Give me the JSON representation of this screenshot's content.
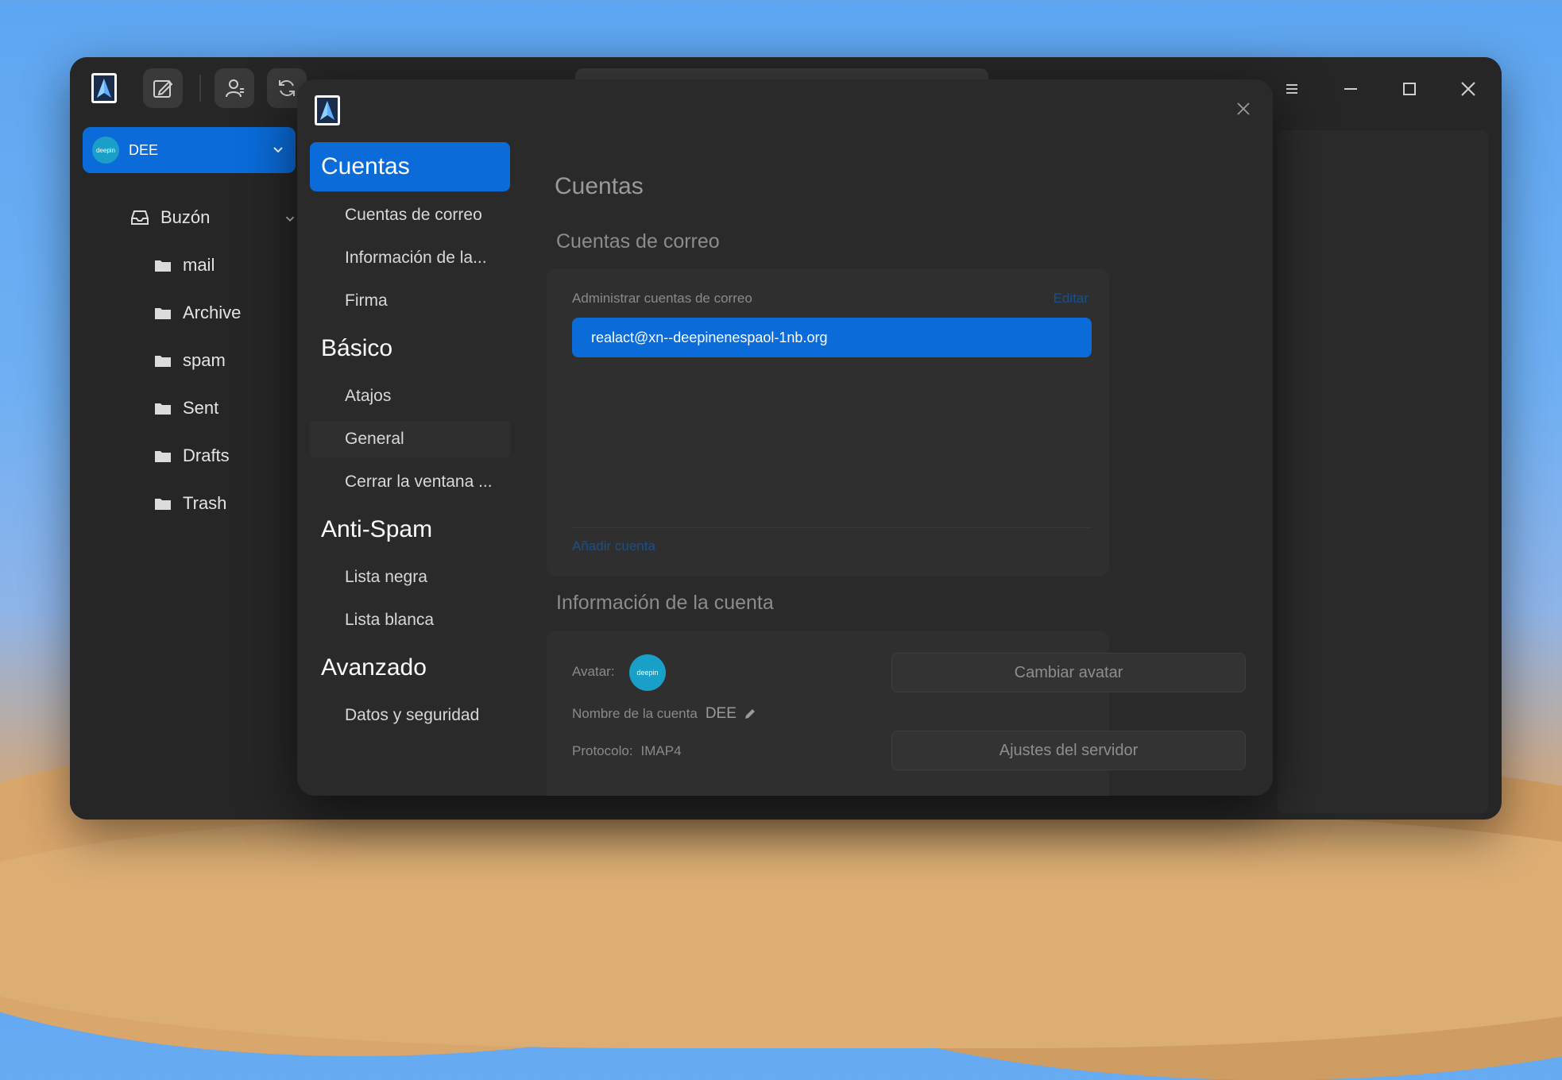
{
  "window": {
    "toolbar": {
      "logo_icon": "deepin-mail-logo-icon",
      "compose_icon": "compose-icon",
      "contacts_icon": "contacts-icon",
      "refresh_icon": "refresh-icon"
    },
    "controls": [
      "menu-icon",
      "minimize-icon",
      "maximize-icon",
      "close-icon"
    ]
  },
  "sidebar": {
    "account": {
      "name": "DEE",
      "avatar_text": "deepin"
    },
    "mailbox": {
      "label": "Buzón"
    },
    "folders": [
      {
        "label": "mail"
      },
      {
        "label": "Archive"
      },
      {
        "label": "spam"
      },
      {
        "label": "Sent"
      },
      {
        "label": "Drafts"
      },
      {
        "label": "Trash"
      }
    ]
  },
  "dialog": {
    "nav": {
      "sections": [
        {
          "title": "Cuentas",
          "items": [
            "Cuentas de correo",
            "Información de la...",
            "Firma"
          ]
        },
        {
          "title": "Básico",
          "items": [
            "Atajos",
            "General",
            "Cerrar la ventana ..."
          ]
        },
        {
          "title": "Anti-Spam",
          "items": [
            "Lista negra",
            "Lista blanca"
          ]
        },
        {
          "title": "Avanzado",
          "items": [
            "Datos y seguridad"
          ]
        }
      ]
    },
    "content": {
      "title": "Cuentas",
      "mail_accounts": {
        "heading": "Cuentas de correo",
        "manage_label": "Administrar cuentas de correo",
        "edit_label": "Editar",
        "accounts": [
          "realact@xn--deepinenespaol-1nb.org"
        ],
        "add_label": "Añadir cuenta"
      },
      "account_info": {
        "heading": "Información de la cuenta",
        "avatar_label": "Avatar:",
        "change_avatar": "Cambiar avatar",
        "name_label": "Nombre de la cuenta",
        "name_value": "DEE",
        "protocol_label": "Protocolo:",
        "protocol_value": "IMAP4",
        "server_settings": "Ajustes del servidor"
      }
    }
  },
  "colors": {
    "accent": "#0a6bd9",
    "window_bg": "#262626",
    "dialog_bg": "#2a2a2a"
  }
}
